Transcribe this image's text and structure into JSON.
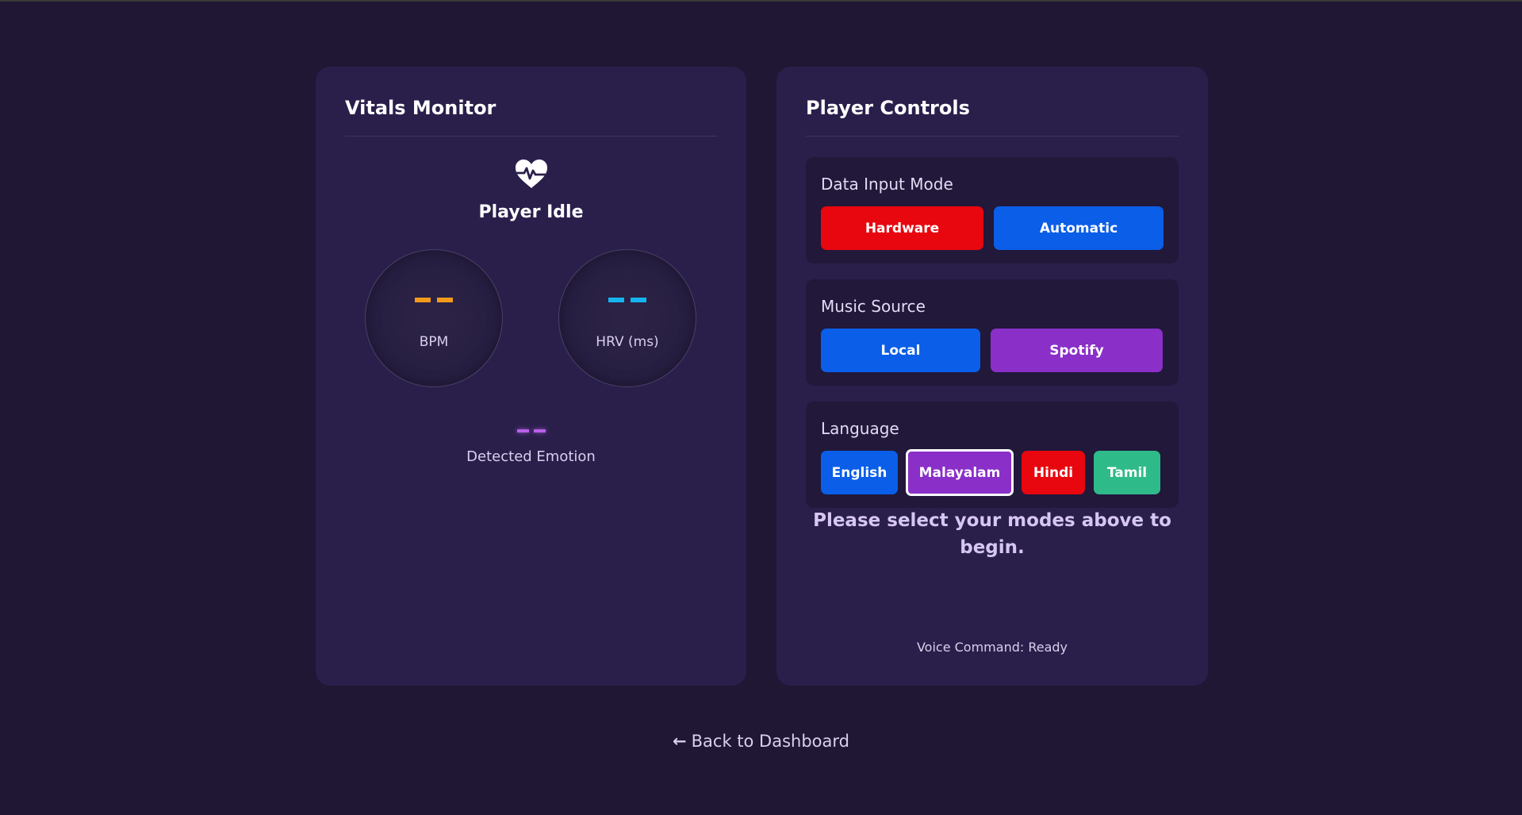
{
  "vitals": {
    "title": "Vitals Monitor",
    "status": "Player Idle",
    "bpm": {
      "value": "--",
      "label": "BPM",
      "color": "#f39a1b"
    },
    "hrv": {
      "value": "--",
      "label": "HRV (ms)",
      "color": "#15b4f0"
    },
    "emotion": {
      "value": "--",
      "label": "Detected Emotion",
      "color": "#b860e8"
    }
  },
  "controls": {
    "title": "Player Controls",
    "input_mode": {
      "title": "Data Input Mode",
      "hardware": "Hardware",
      "automatic": "Automatic"
    },
    "music_source": {
      "title": "Music Source",
      "local": "Local",
      "spotify": "Spotify"
    },
    "language": {
      "title": "Language",
      "english": "English",
      "malayalam": "Malayalam",
      "hindi": "Hindi",
      "tamil": "Tamil",
      "selected": "Malayalam"
    },
    "prompt": "Please select your modes above to begin.",
    "voice_status": "Voice Command: Ready"
  },
  "nav": {
    "back_label": "Back to Dashboard"
  },
  "colors": {
    "background": "#1f1733",
    "card": "#2a1f4b",
    "red": "#e8060f",
    "blue": "#0a5ee8",
    "purple": "#8a2fc8",
    "green": "#2fba8a"
  },
  "icons": {
    "status": "heart-pulse-icon",
    "back": "arrow-left-icon"
  }
}
